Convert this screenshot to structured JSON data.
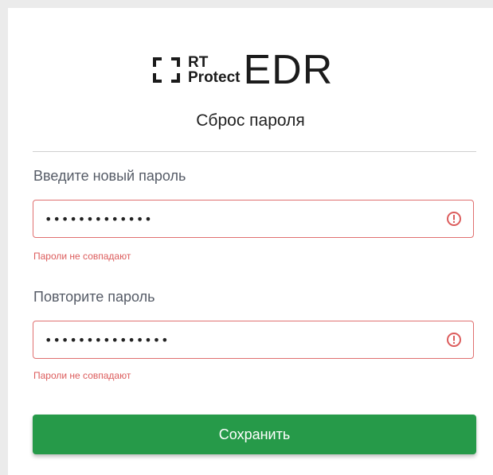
{
  "logo": {
    "line1": "RT",
    "line2": "Protect",
    "product": "EDR"
  },
  "form": {
    "title": "Сброс пароля",
    "new_password": {
      "label": "Введите новый пароль",
      "value": "•••••••••••••",
      "error": "Пароли не совпадают"
    },
    "repeat_password": {
      "label": "Повторите пароль",
      "value": "•••••••••••••••",
      "error": "Пароли не совпадают"
    },
    "save_label": "Сохранить"
  },
  "colors": {
    "accent": "#269a49",
    "error": "#dc5c5c",
    "error_border": "#e07070"
  }
}
